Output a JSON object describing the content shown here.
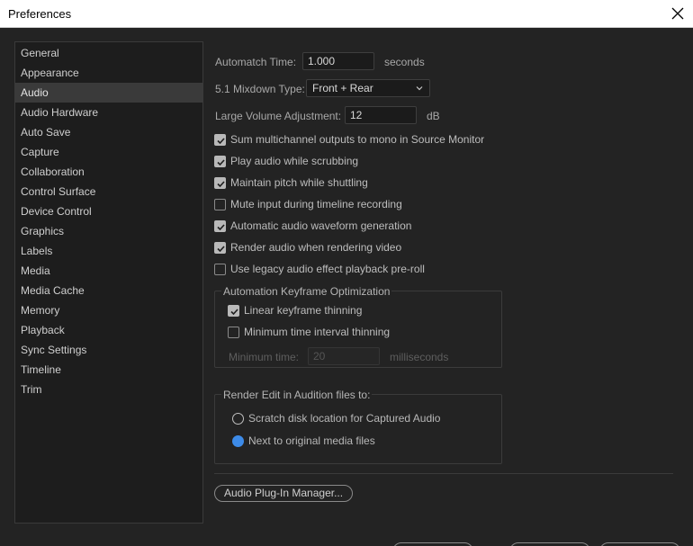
{
  "window": {
    "title": "Preferences"
  },
  "sidebar": {
    "items": [
      {
        "label": "General"
      },
      {
        "label": "Appearance"
      },
      {
        "label": "Audio"
      },
      {
        "label": "Audio Hardware"
      },
      {
        "label": "Auto Save"
      },
      {
        "label": "Capture"
      },
      {
        "label": "Collaboration"
      },
      {
        "label": "Control Surface"
      },
      {
        "label": "Device Control"
      },
      {
        "label": "Graphics"
      },
      {
        "label": "Labels"
      },
      {
        "label": "Media"
      },
      {
        "label": "Media Cache"
      },
      {
        "label": "Memory"
      },
      {
        "label": "Playback"
      },
      {
        "label": "Sync Settings"
      },
      {
        "label": "Timeline"
      },
      {
        "label": "Trim"
      }
    ],
    "selected": "Audio"
  },
  "audio": {
    "automatch": {
      "label": "Automatch Time:",
      "value": "1.000",
      "unit": "seconds"
    },
    "mixdown": {
      "label": "5.1 Mixdown Type:",
      "value": "Front + Rear"
    },
    "large_volume": {
      "label": "Large Volume Adjustment:",
      "value": "12",
      "unit": "dB"
    },
    "checkboxes": [
      {
        "label": "Sum multichannel outputs to mono in Source Monitor",
        "checked": true
      },
      {
        "label": "Play audio while scrubbing",
        "checked": true
      },
      {
        "label": "Maintain pitch while shuttling",
        "checked": true
      },
      {
        "label": "Mute input during timeline recording",
        "checked": false
      },
      {
        "label": "Automatic audio waveform generation",
        "checked": true
      },
      {
        "label": "Render audio when rendering video",
        "checked": true
      },
      {
        "label": "Use legacy audio effect playback pre-roll",
        "checked": false
      }
    ],
    "automation_group": {
      "title": "Automation Keyframe Optimization",
      "linear_thinning": {
        "label": "Linear keyframe thinning",
        "checked": true
      },
      "min_interval": {
        "label": "Minimum time interval thinning",
        "checked": false
      },
      "min_time": {
        "label": "Minimum time:",
        "value": "20",
        "unit": "milliseconds"
      }
    },
    "render_group": {
      "title": "Render Edit in Audition files to:",
      "options": [
        {
          "label": "Scratch disk location for Captured Audio",
          "selected": false
        },
        {
          "label": "Next to original media files",
          "selected": true
        }
      ]
    },
    "plugin_manager_label": "Audio Plug-In Manager..."
  },
  "colors": {
    "accent": "#3d8be8",
    "background": "#232323",
    "sidebar_selected": "#3a3a3a"
  },
  "icons": {
    "close": "close-icon",
    "dropdown": "chevron-down-icon",
    "check": "checkmark-icon"
  }
}
